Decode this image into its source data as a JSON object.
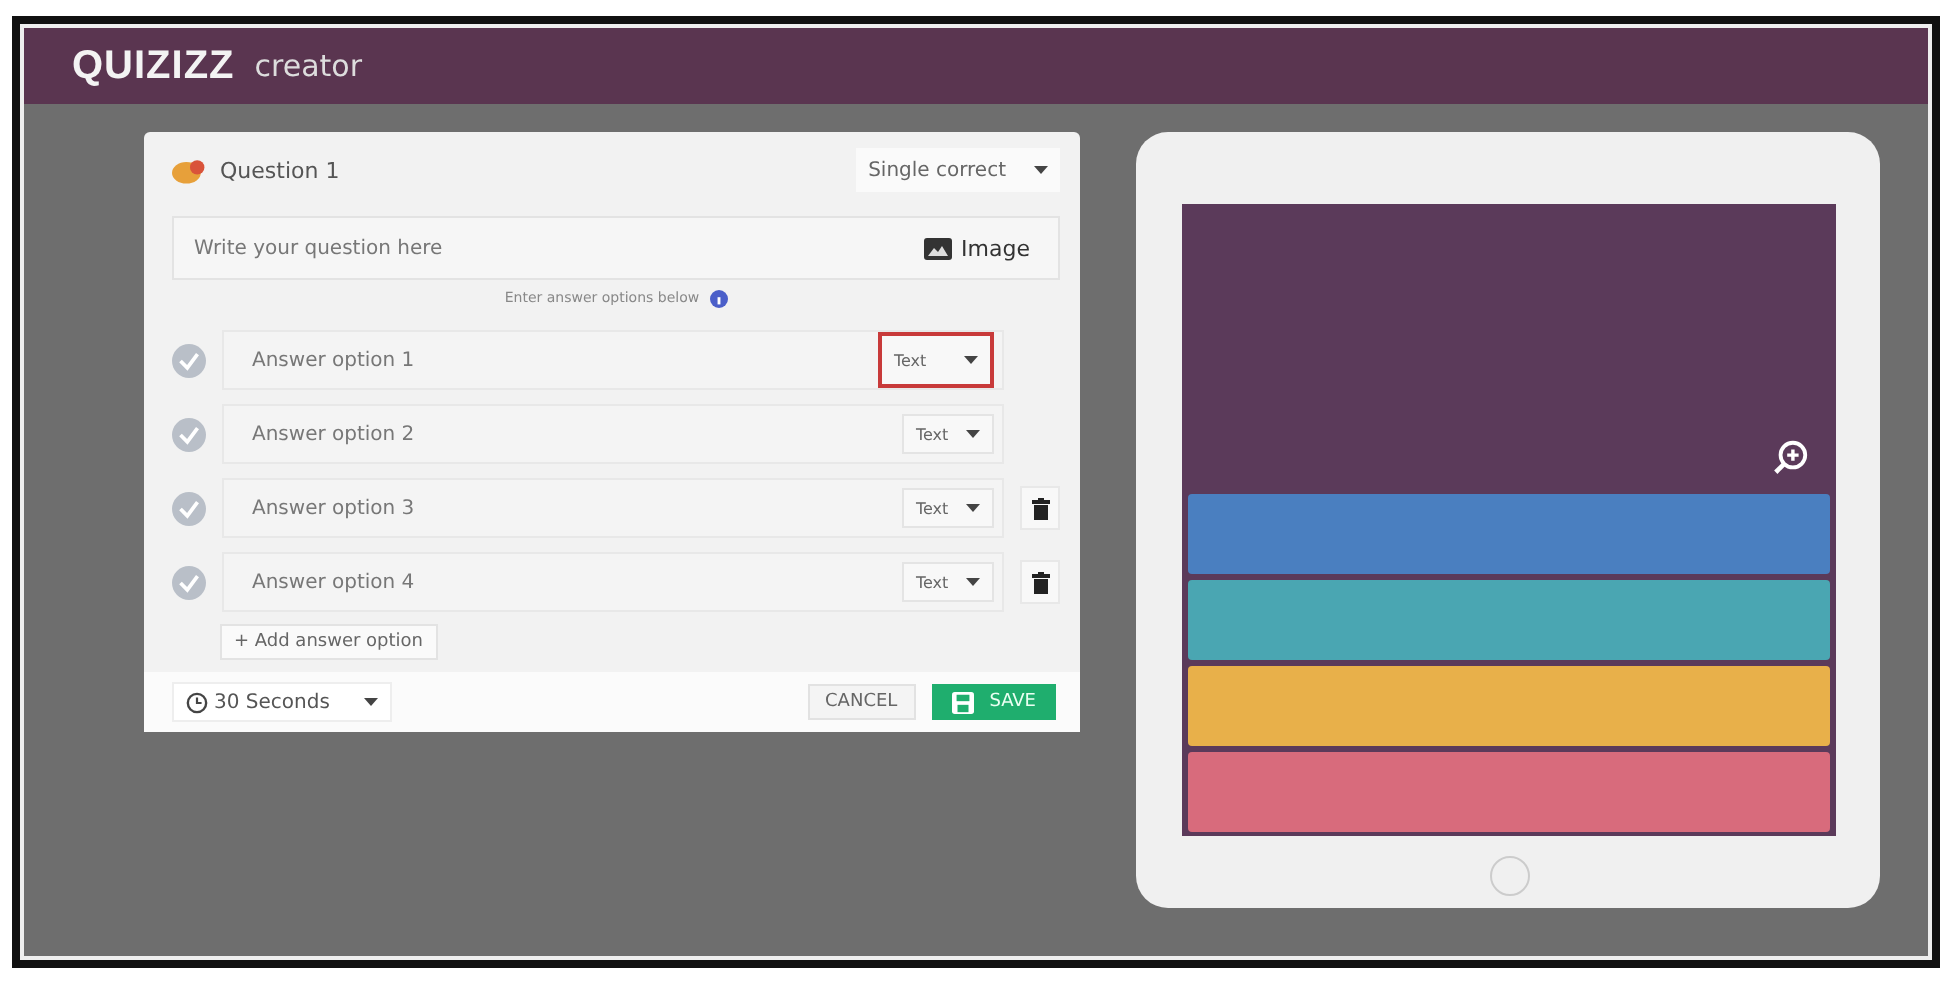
{
  "header": {
    "logo": "QUIZIZZ",
    "subtitle": "creator"
  },
  "question": {
    "title": "Question 1",
    "type": "Single correct",
    "placeholder": "Write your question here",
    "image_button": "Image",
    "hint": "Enter answer options below"
  },
  "answers": [
    {
      "placeholder": "Answer option 1",
      "format": "Text",
      "highlighted": true,
      "deletable": false
    },
    {
      "placeholder": "Answer option 2",
      "format": "Text",
      "highlighted": false,
      "deletable": false
    },
    {
      "placeholder": "Answer option 3",
      "format": "Text",
      "highlighted": false,
      "deletable": true
    },
    {
      "placeholder": "Answer option 4",
      "format": "Text",
      "highlighted": false,
      "deletable": true
    }
  ],
  "add_button": "+ Add answer option",
  "footer": {
    "timer": "30 Seconds",
    "cancel": "CANCEL",
    "save": "SAVE"
  },
  "preview": {
    "options": [
      {
        "color": "#4a7fc0"
      },
      {
        "color": "#4aa6b2"
      },
      {
        "color": "#e8b04a"
      },
      {
        "color": "#d86b7c"
      }
    ]
  }
}
